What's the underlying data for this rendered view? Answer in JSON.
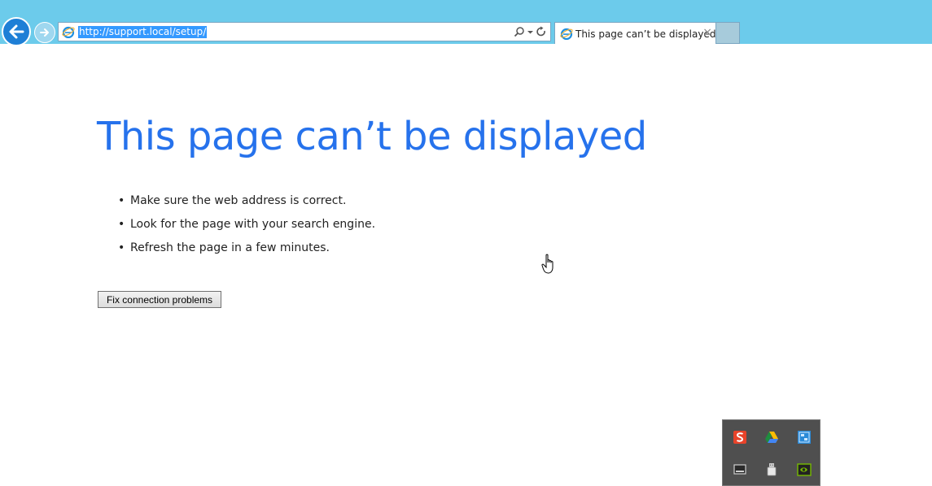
{
  "browser": {
    "address_url": "http://support.local/setup/",
    "tab_title": "This page can’t be displayed",
    "tab_close_glyph": "×",
    "back_icon": "back-arrow-icon",
    "forward_icon": "forward-arrow-icon",
    "address_tools": [
      "search-icon",
      "dropdown-icon",
      "refresh-icon"
    ]
  },
  "error_page": {
    "title": "This page can’t be displayed",
    "bullet_glyph": "•",
    "suggestions": [
      "Make sure the web address is correct.",
      "Look for the page with your search engine.",
      "Refresh the page in a few minutes."
    ],
    "fix_button_label": "Fix connection problems"
  },
  "tray": {
    "icons": [
      "sogou-icon",
      "google-drive-icon",
      "network-monitor-icon",
      "display-icon",
      "usb-drive-icon",
      "nvidia-icon"
    ]
  },
  "colors": {
    "topbar": "#6ccbeb",
    "title_blue": "#2672ec",
    "selection": "#3399ff"
  }
}
